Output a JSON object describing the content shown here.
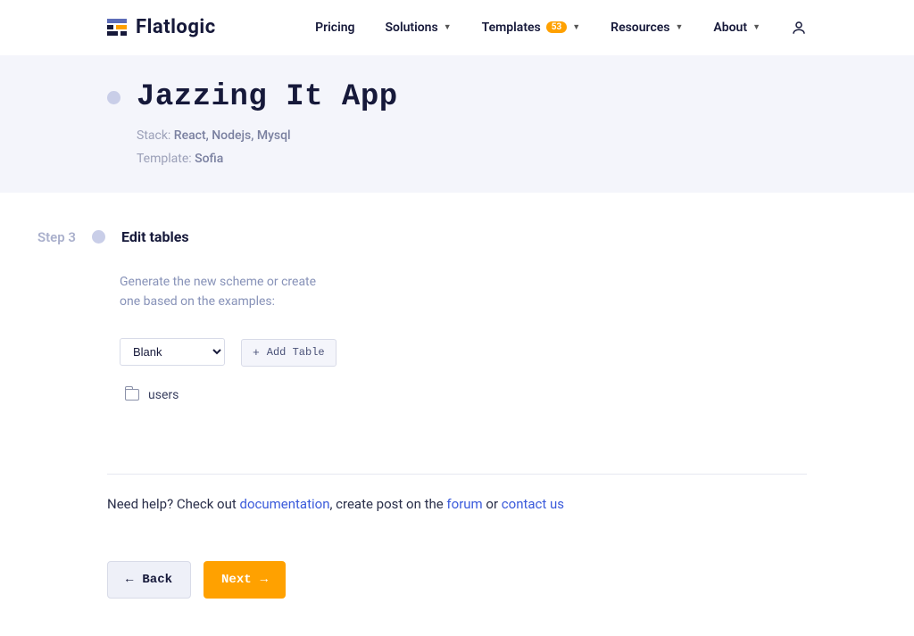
{
  "header": {
    "brand": "Flatlogic",
    "nav": {
      "pricing": "Pricing",
      "solutions": "Solutions",
      "templates": "Templates",
      "templates_badge": "53",
      "resources": "Resources",
      "about": "About"
    }
  },
  "banner": {
    "title": "Jazzing It App",
    "stack_label": "Stack: ",
    "stack_value": "React, Nodejs, Mysql",
    "template_label": "Template: ",
    "template_value": "Sofia"
  },
  "step": {
    "label": "Step 3",
    "title": "Edit tables"
  },
  "form": {
    "description": "Generate the new scheme or create one based on the examples:",
    "select_value": "Blank",
    "add_table": "Add Table"
  },
  "tables": [
    {
      "name": "users"
    }
  ],
  "help": {
    "prefix": "Need help? Check out ",
    "doc": "documentation",
    "mid1": ", create post on the ",
    "forum": "forum",
    "mid2": " or ",
    "contact": "contact us"
  },
  "actions": {
    "back": "Back",
    "next": "Next"
  }
}
